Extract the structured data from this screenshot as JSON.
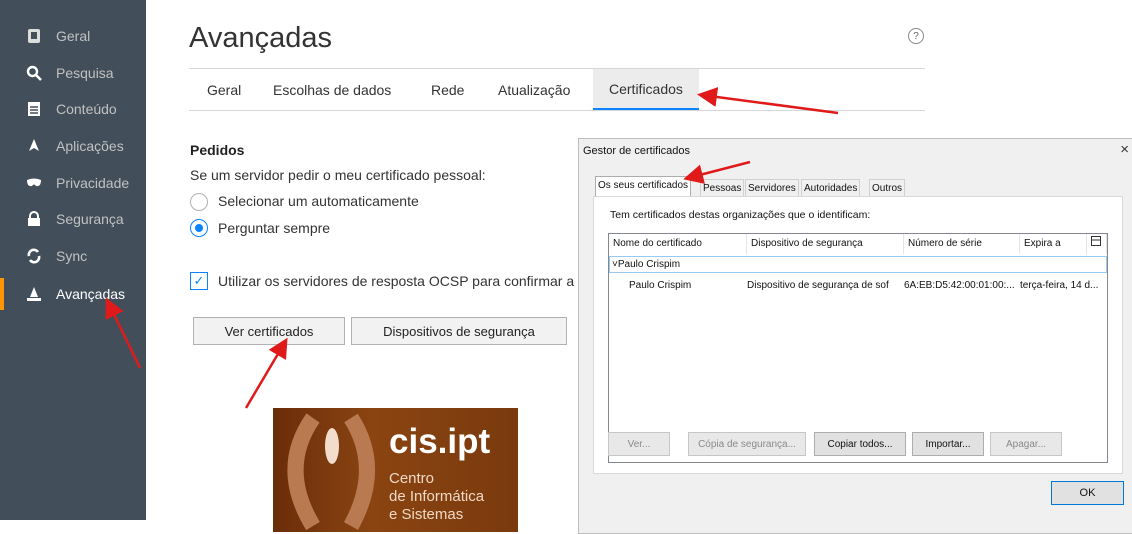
{
  "sidebar": {
    "items": [
      {
        "label": "Geral",
        "icon": "page-icon"
      },
      {
        "label": "Pesquisa",
        "icon": "search-icon"
      },
      {
        "label": "Conteúdo",
        "icon": "document-icon"
      },
      {
        "label": "Aplicações",
        "icon": "rocket-icon"
      },
      {
        "label": "Privacidade",
        "icon": "mask-icon"
      },
      {
        "label": "Segurança",
        "icon": "lock-icon"
      },
      {
        "label": "Sync",
        "icon": "sync-icon"
      },
      {
        "label": "Avançadas",
        "icon": "wizard-icon"
      }
    ],
    "active_index": 7
  },
  "main": {
    "title": "Avançadas",
    "help": "?",
    "tabs": [
      "Geral",
      "Escolhas de dados",
      "Rede",
      "Atualização",
      "Certificados"
    ],
    "active_tab": "Certificados",
    "pedidos_title": "Pedidos",
    "pedidos_desc": "Se um servidor pedir o meu certificado pessoal:",
    "radio_auto": "Selecionar um automaticamente",
    "radio_ask": "Perguntar sempre",
    "ocsp_label": "Utilizar os servidores de resposta OCSP para confirmar a va",
    "btn_view": "Ver certificados",
    "btn_devices": "Dispositivos de segurança"
  },
  "dialog": {
    "title": "Gestor de certificados",
    "close": "×",
    "tabs": [
      "Os seus certificados",
      "Pessoas",
      "Servidores",
      "Autoridades",
      "Outros"
    ],
    "desc": "Tem certificados destas organizações que o identificam:",
    "columns": [
      "Nome do certificado",
      "Dispositivo de segurança",
      "Número de série",
      "Expira a"
    ],
    "group": "Paulo Crispim",
    "row": {
      "name": "Paulo Crispim",
      "device": "Dispositivo de segurança de sof",
      "serial": "6A:EB:D5:42:00:01:00:...",
      "expires": "terça-feira, 14 d..."
    },
    "buttons": [
      "Ver...",
      "Cópia de segurança...",
      "Copiar todos...",
      "Importar...",
      "Apagar..."
    ],
    "ok": "OK"
  },
  "logo": {
    "main": "cis.ipt",
    "line1": "Centro",
    "line2": "de Informática",
    "line3": "e Sistemas"
  },
  "colors": {
    "accent": "#0a84ff",
    "sidebar": "#424f5a",
    "arrow": "#e01a1a",
    "active_marker": "#ff9500"
  }
}
